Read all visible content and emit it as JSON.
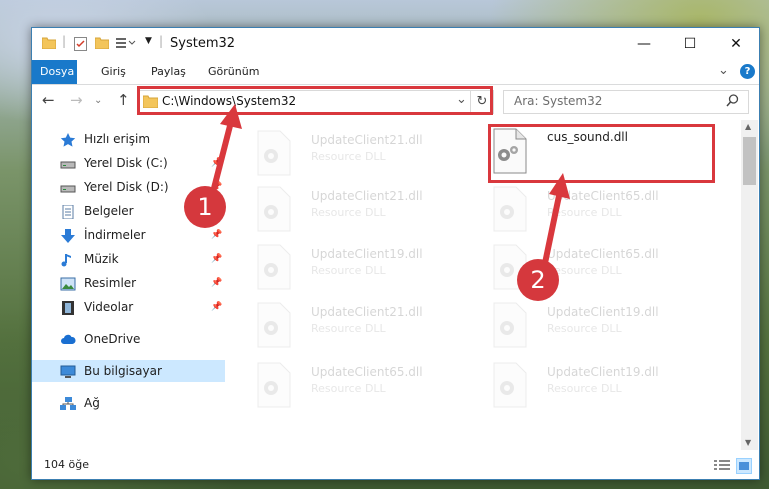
{
  "window": {
    "title": "System32",
    "minimize_glyph": "—",
    "maximize_glyph": "☐",
    "close_glyph": "✕"
  },
  "ribbon": {
    "tabs": [
      {
        "label": "Dosya",
        "active": true
      },
      {
        "label": "Giriş",
        "active": false
      },
      {
        "label": "Paylaş",
        "active": false
      },
      {
        "label": "Görünüm",
        "active": false
      }
    ],
    "help_glyph": "?",
    "expand_glyph": "⌄"
  },
  "nav": {
    "back_glyph": "←",
    "forward_glyph": "→",
    "up_glyph": "↑",
    "history_glyph": "⌄",
    "address": "C:\\Windows\\System32",
    "refresh_glyph": "↻",
    "search_placeholder": "Ara: System32"
  },
  "sidebar": {
    "items": [
      {
        "label": "Hızlı erişim",
        "icon": "star-icon",
        "pinned": false
      },
      {
        "label": "Yerel Disk (C:)",
        "icon": "drive-icon",
        "pinned": true
      },
      {
        "label": "Yerel Disk (D:)",
        "icon": "drive-icon",
        "pinned": true
      },
      {
        "label": "Belgeler",
        "icon": "document-icon",
        "pinned": true
      },
      {
        "label": "İndirmeler",
        "icon": "download-icon",
        "pinned": true
      },
      {
        "label": "Müzik",
        "icon": "music-icon",
        "pinned": true
      },
      {
        "label": "Resimler",
        "icon": "pictures-icon",
        "pinned": true
      },
      {
        "label": "Videolar",
        "icon": "video-icon",
        "pinned": true
      },
      {
        "label": "OneDrive",
        "icon": "cloud-icon",
        "pinned": false
      },
      {
        "label": "Bu bilgisayar",
        "icon": "computer-icon",
        "pinned": false,
        "selected": true
      },
      {
        "label": "Ağ",
        "icon": "network-icon",
        "pinned": false
      }
    ]
  },
  "files": [
    {
      "name": "UpdateClient21.dll",
      "type": "Resource DLL",
      "faded": true
    },
    {
      "name": "cus_sound.dll",
      "type": "",
      "faded": false,
      "highlighted": true
    },
    {
      "name": "UpdateClient21.dll",
      "type": "Resource DLL",
      "faded": true
    },
    {
      "name": "UpdateClient65.dll",
      "type": "Resource DLL",
      "faded": true
    },
    {
      "name": "UpdateClient19.dll",
      "type": "Resource DLL",
      "faded": true
    },
    {
      "name": "UpdateClient65.dll",
      "type": "Resource DLL",
      "faded": true
    },
    {
      "name": "UpdateClient21.dll",
      "type": "Resource DLL",
      "faded": true
    },
    {
      "name": "UpdateClient19.dll",
      "type": "Resource DLL",
      "faded": true
    },
    {
      "name": "UpdateClient65.dll",
      "type": "Resource DLL",
      "faded": true
    },
    {
      "name": "UpdateClient19.dll",
      "type": "Resource DLL",
      "faded": true
    }
  ],
  "status": {
    "item_count": "104 öğe"
  },
  "annotations": {
    "badge_1": "1",
    "badge_2": "2",
    "color": "#d9383d"
  }
}
